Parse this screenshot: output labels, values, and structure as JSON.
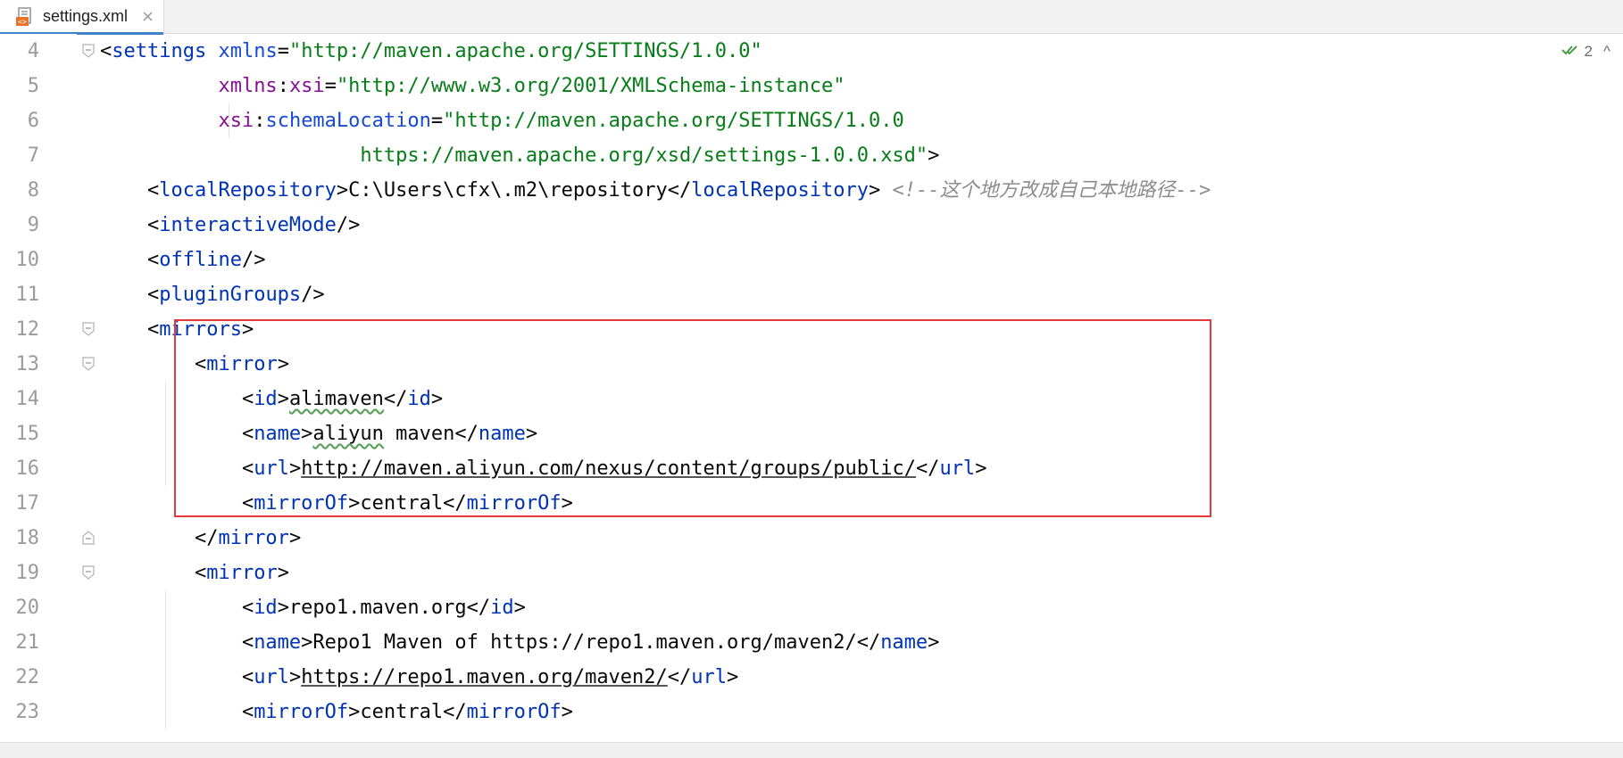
{
  "tab": {
    "filename": "settings.xml",
    "icon": "xml-file-icon",
    "close": "×"
  },
  "inspection": {
    "count": "2",
    "icon": "check-double-icon",
    "arrow": "^"
  },
  "colors": {
    "tag": "#0033b3",
    "attr": "#174ad4",
    "ns": "#871094",
    "string": "#067d17",
    "comment": "#8c8c8c",
    "box": "#e03a3a"
  },
  "lines": [
    {
      "n": "4",
      "fold": "open",
      "segs": [
        [
          "p",
          "<"
        ],
        [
          "t",
          "settings"
        ],
        [
          "p",
          " "
        ],
        [
          "a",
          "xmlns"
        ],
        [
          "p",
          "="
        ],
        [
          "s",
          "\"http://maven.apache.org/SETTINGS/1.0.0\""
        ]
      ]
    },
    {
      "n": "5",
      "segs": [
        [
          "p",
          "          "
        ],
        [
          "ns",
          "xmlns"
        ],
        [
          "p",
          ":"
        ],
        [
          "ns",
          "xsi"
        ],
        [
          "p",
          "="
        ],
        [
          "s",
          "\"http://www.w3.org/2001/XMLSchema-instance\""
        ]
      ]
    },
    {
      "n": "6",
      "segs": [
        [
          "p",
          "          "
        ],
        [
          "ns",
          "xsi"
        ],
        [
          "p",
          ":"
        ],
        [
          "a",
          "schemaLocation"
        ],
        [
          "p",
          "="
        ],
        [
          "s",
          "\"http://maven.apache.org/SETTINGS/1.0.0"
        ]
      ]
    },
    {
      "n": "7",
      "segs": [
        [
          "p",
          "                      "
        ],
        [
          "s",
          "https://maven.apache.org/xsd/settings-1.0.0.xsd\""
        ],
        [
          "p",
          ">"
        ]
      ]
    },
    {
      "n": "8",
      "segs": [
        [
          "p",
          "    <"
        ],
        [
          "t",
          "localRepository"
        ],
        [
          "p",
          ">C:\\Users\\cfx\\.m2\\repository</"
        ],
        [
          "t",
          "localRepository"
        ],
        [
          "p",
          "> "
        ],
        [
          "c",
          "<!--这个地方改成自己本地路径-->"
        ]
      ]
    },
    {
      "n": "9",
      "segs": [
        [
          "p",
          "    <"
        ],
        [
          "t",
          "interactiveMode"
        ],
        [
          "p",
          "/>"
        ]
      ]
    },
    {
      "n": "10",
      "segs": [
        [
          "p",
          "    <"
        ],
        [
          "t",
          "offline"
        ],
        [
          "p",
          "/>"
        ]
      ]
    },
    {
      "n": "11",
      "segs": [
        [
          "p",
          "    <"
        ],
        [
          "t",
          "pluginGroups"
        ],
        [
          "p",
          "/>"
        ]
      ]
    },
    {
      "n": "12",
      "fold": "open",
      "segs": [
        [
          "p",
          "    <"
        ],
        [
          "t",
          "mirrors"
        ],
        [
          "p",
          ">"
        ]
      ]
    },
    {
      "n": "13",
      "fold": "open",
      "segs": [
        [
          "p",
          "        <"
        ],
        [
          "t",
          "mirror"
        ],
        [
          "p",
          ">"
        ]
      ]
    },
    {
      "n": "14",
      "segs": [
        [
          "p",
          "            <"
        ],
        [
          "t",
          "id"
        ],
        [
          "p",
          ">"
        ],
        [
          "w",
          "alimaven"
        ],
        [
          "p",
          "</"
        ],
        [
          "t",
          "id"
        ],
        [
          "p",
          ">"
        ]
      ]
    },
    {
      "n": "15",
      "segs": [
        [
          "p",
          "            <"
        ],
        [
          "t",
          "name"
        ],
        [
          "p",
          ">"
        ],
        [
          "w",
          "aliyun"
        ],
        [
          "p",
          " maven</"
        ],
        [
          "t",
          "name"
        ],
        [
          "p",
          ">"
        ]
      ]
    },
    {
      "n": "16",
      "segs": [
        [
          "p",
          "            <"
        ],
        [
          "t",
          "url"
        ],
        [
          "p",
          ">"
        ],
        [
          "u",
          "http://maven.aliyun.com/nexus/content/groups/public/"
        ],
        [
          "p",
          "</"
        ],
        [
          "t",
          "url"
        ],
        [
          "p",
          ">"
        ]
      ]
    },
    {
      "n": "17",
      "segs": [
        [
          "p",
          "            <"
        ],
        [
          "t",
          "mirrorOf"
        ],
        [
          "p",
          ">central</"
        ],
        [
          "t",
          "mirrorOf"
        ],
        [
          "p",
          ">"
        ]
      ]
    },
    {
      "n": "18",
      "fold": "close",
      "segs": [
        [
          "p",
          "        </"
        ],
        [
          "t",
          "mirror"
        ],
        [
          "p",
          ">"
        ]
      ]
    },
    {
      "n": "19",
      "fold": "open",
      "segs": [
        [
          "p",
          "        <"
        ],
        [
          "t",
          "mirror"
        ],
        [
          "p",
          ">"
        ]
      ]
    },
    {
      "n": "20",
      "segs": [
        [
          "p",
          "            <"
        ],
        [
          "t",
          "id"
        ],
        [
          "p",
          ">repo1.maven.org</"
        ],
        [
          "t",
          "id"
        ],
        [
          "p",
          ">"
        ]
      ]
    },
    {
      "n": "21",
      "segs": [
        [
          "p",
          "            <"
        ],
        [
          "t",
          "name"
        ],
        [
          "p",
          ">Repo1 Maven of https://repo1.maven.org/maven2/</"
        ],
        [
          "t",
          "name"
        ],
        [
          "p",
          ">"
        ]
      ]
    },
    {
      "n": "22",
      "segs": [
        [
          "p",
          "            <"
        ],
        [
          "t",
          "url"
        ],
        [
          "p",
          ">"
        ],
        [
          "u",
          "https://repo1.maven.org/maven2/"
        ],
        [
          "p",
          "</"
        ],
        [
          "t",
          "url"
        ],
        [
          "p",
          ">"
        ]
      ]
    },
    {
      "n": "23",
      "segs": [
        [
          "p",
          "            <"
        ],
        [
          "t",
          "mirrorOf"
        ],
        [
          "p",
          ">central</"
        ],
        [
          "t",
          "mirrorOf"
        ],
        [
          "p",
          ">"
        ]
      ]
    }
  ]
}
